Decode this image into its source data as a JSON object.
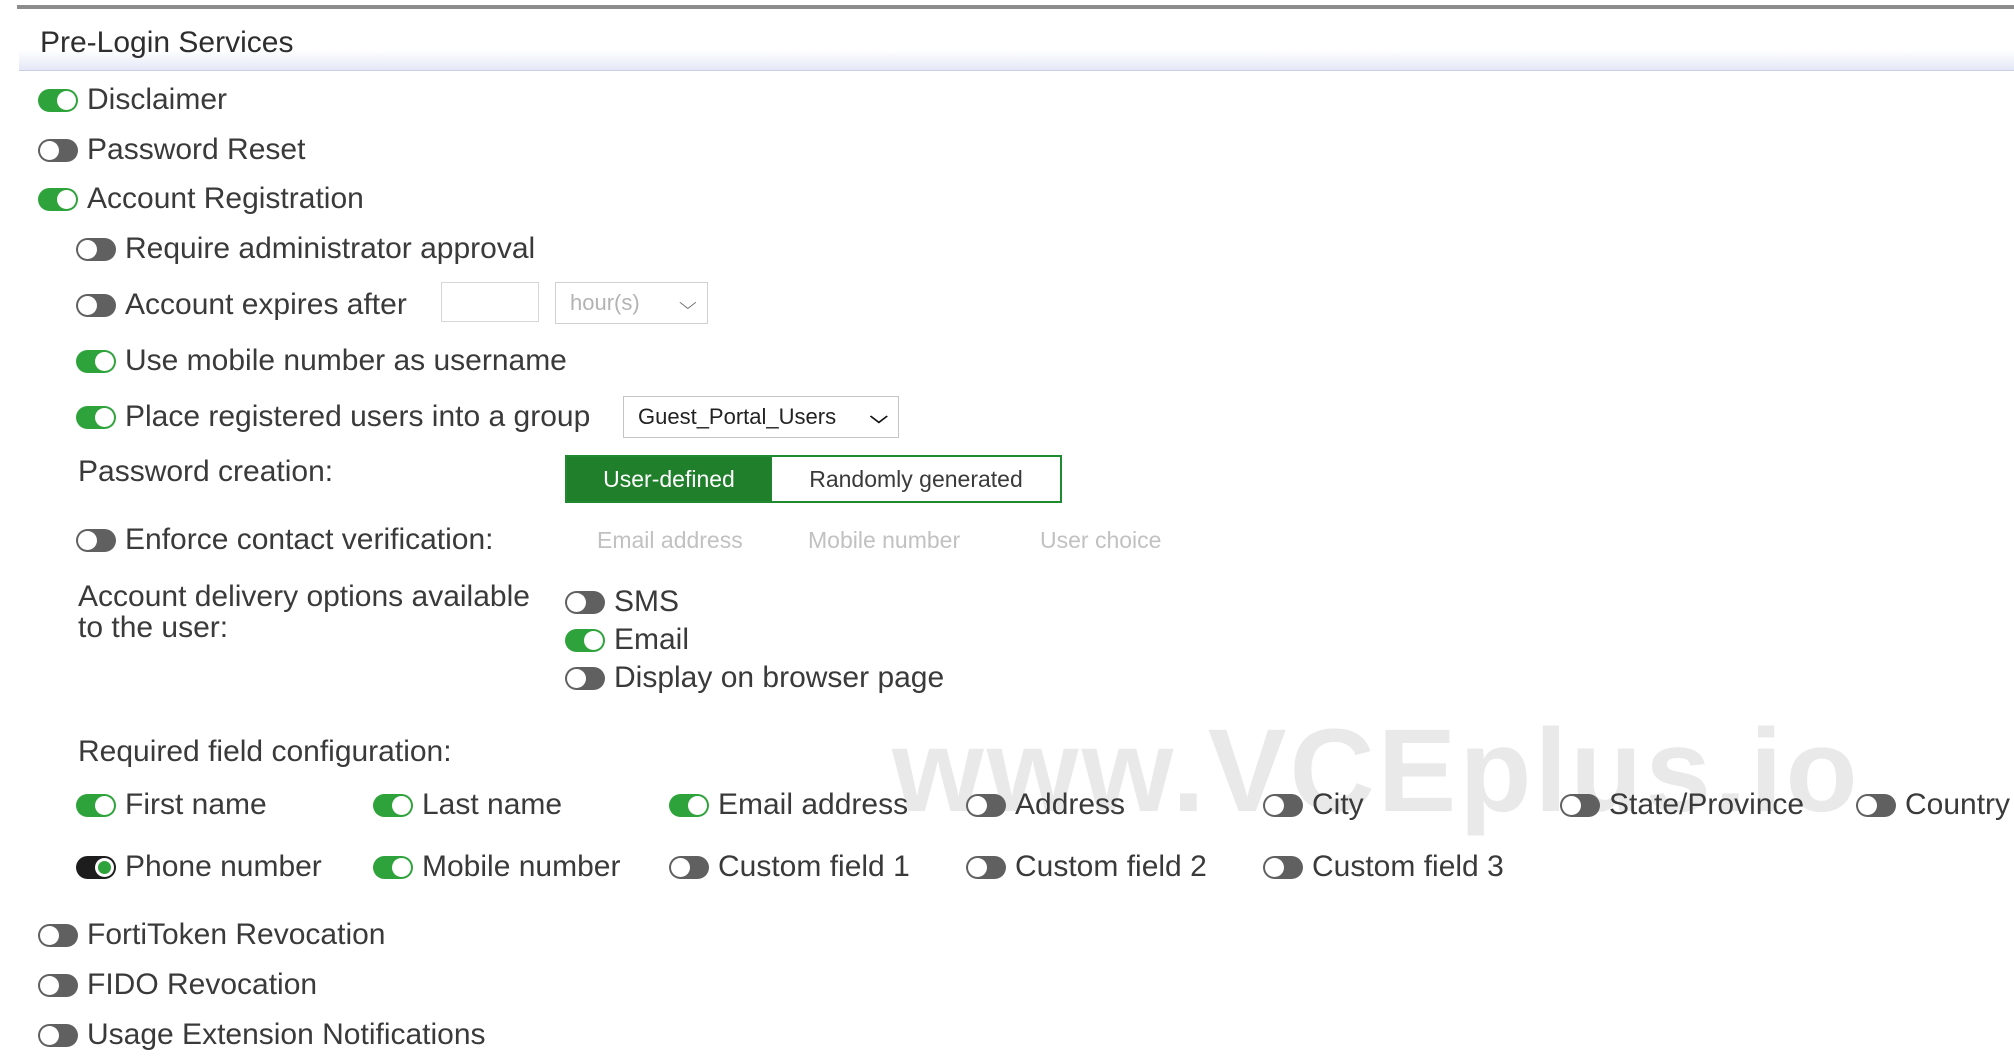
{
  "section": {
    "title": "Pre-Login Services"
  },
  "services": {
    "disclaimer": {
      "label": "Disclaimer",
      "enabled": true
    },
    "password_reset": {
      "label": "Password Reset",
      "enabled": false
    },
    "account_registration": {
      "label": "Account Registration",
      "enabled": true
    },
    "fortitoken_revocation": {
      "label": "FortiToken Revocation",
      "enabled": false
    },
    "fido_revocation": {
      "label": "FIDO Revocation",
      "enabled": false
    },
    "usage_extension": {
      "label": "Usage Extension Notifications",
      "enabled": false
    }
  },
  "registration": {
    "require_approval": {
      "label": "Require administrator approval",
      "enabled": false
    },
    "account_expires": {
      "label": "Account expires after",
      "enabled": false,
      "value": "",
      "unit": "hour(s)"
    },
    "mobile_as_username": {
      "label": "Use mobile number as username",
      "enabled": true
    },
    "place_in_group": {
      "label": "Place registered users into a group",
      "enabled": true,
      "group": "Guest_Portal_Users"
    },
    "password_creation": {
      "label": "Password creation:",
      "options": [
        "User-defined",
        "Randomly generated"
      ],
      "selected": "User-defined"
    },
    "contact_verification": {
      "label": "Enforce contact verification:",
      "enabled": false,
      "options": [
        "Email address",
        "Mobile number",
        "User choice"
      ]
    },
    "delivery": {
      "label_line1": "Account delivery options available",
      "label_line2": "to the user:",
      "options": [
        {
          "label": "SMS",
          "enabled": false
        },
        {
          "label": "Email",
          "enabled": true
        },
        {
          "label": "Display on browser page",
          "enabled": false
        }
      ]
    },
    "required_fields": {
      "label": "Required field configuration:",
      "fields": [
        {
          "label": "First name",
          "enabled": true
        },
        {
          "label": "Last name",
          "enabled": true
        },
        {
          "label": "Email address",
          "enabled": true
        },
        {
          "label": "Address",
          "enabled": false
        },
        {
          "label": "City",
          "enabled": false
        },
        {
          "label": "State/Province",
          "enabled": false
        },
        {
          "label": "Country",
          "enabled": false
        },
        {
          "label": "Phone number",
          "enabled": true
        },
        {
          "label": "Mobile number",
          "enabled": true
        },
        {
          "label": "Custom field 1",
          "enabled": false
        },
        {
          "label": "Custom field 2",
          "enabled": false
        },
        {
          "label": "Custom field 3",
          "enabled": false
        }
      ]
    }
  },
  "watermark": "www.VCEplus.io",
  "colors": {
    "toggle_on": "#2fa33b",
    "toggle_off": "#606060",
    "segment_active": "#1f7f2b",
    "header_band": "#e4e8f6"
  }
}
